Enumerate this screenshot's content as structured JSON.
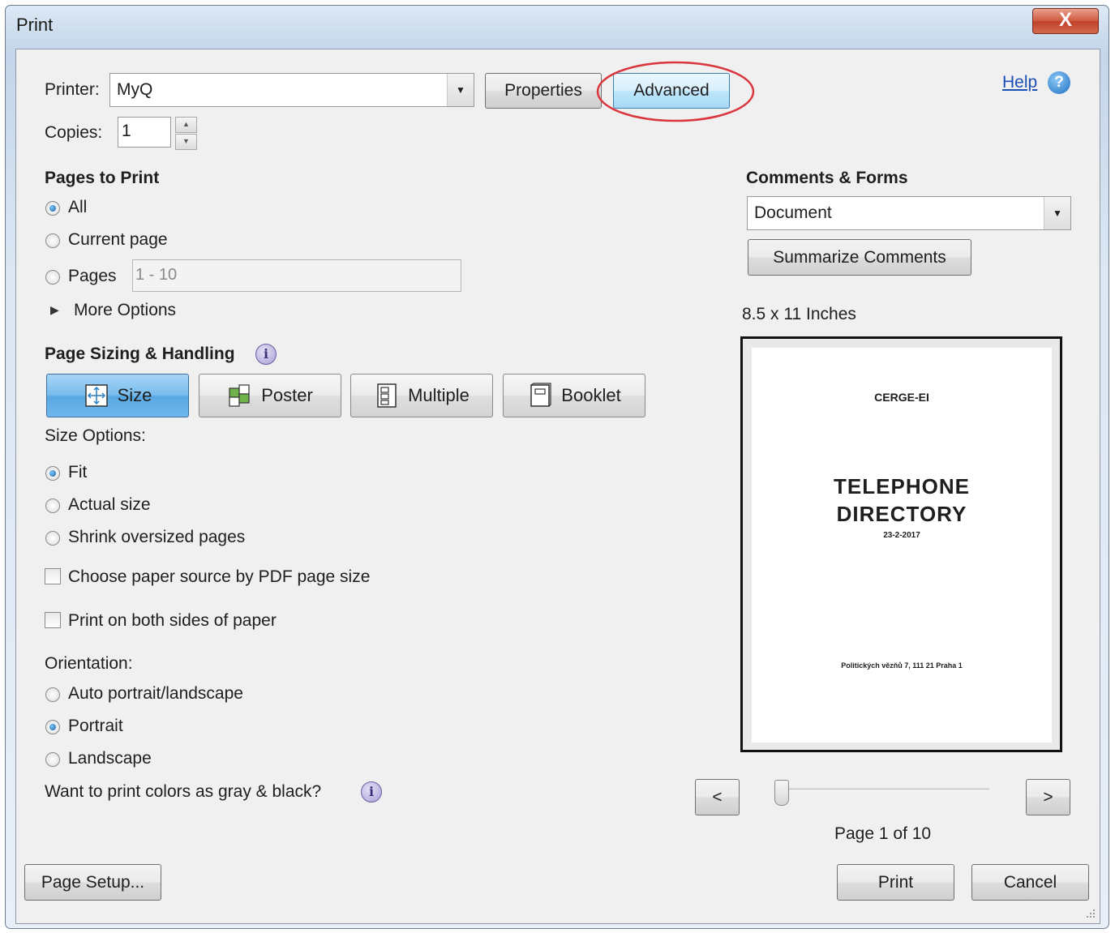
{
  "window": {
    "title": "Print",
    "close_glyph": "X"
  },
  "printer": {
    "label": "Printer:",
    "value": "MyQ",
    "properties_label": "Properties",
    "advanced_label": "Advanced"
  },
  "copies": {
    "label": "Copies:",
    "value": "1"
  },
  "help": {
    "label": "Help",
    "icon": "help-icon"
  },
  "pages_to_print": {
    "heading": "Pages to Print",
    "all_label": "All",
    "current_label": "Current page",
    "pages_label": "Pages",
    "pages_value": "1 - 10",
    "more_options_label": "More Options",
    "selected": "All"
  },
  "page_sizing": {
    "heading": "Page Sizing & Handling",
    "tabs": [
      {
        "label": "Size",
        "icon": "size-icon",
        "selected": true
      },
      {
        "label": "Poster",
        "icon": "poster-icon",
        "selected": false
      },
      {
        "label": "Multiple",
        "icon": "multiple-icon",
        "selected": false
      },
      {
        "label": "Booklet",
        "icon": "booklet-icon",
        "selected": false
      }
    ],
    "size_options_label": "Size Options:",
    "fit_label": "Fit",
    "actual_label": "Actual size",
    "shrink_label": "Shrink oversized pages",
    "selected": "Fit",
    "paper_source_label": "Choose paper source by PDF page size",
    "paper_source_checked": false,
    "both_sides_label": "Print on both sides of paper",
    "both_sides_checked": false
  },
  "orientation": {
    "label": "Orientation:",
    "auto_label": "Auto portrait/landscape",
    "portrait_label": "Portrait",
    "landscape_label": "Landscape",
    "selected": "Portrait"
  },
  "gray_label": "Want to print colors as gray & black?",
  "comments_forms": {
    "heading": "Comments & Forms",
    "value": "Document",
    "summarize_label": "Summarize Comments"
  },
  "preview": {
    "paper_size": "8.5 x 11 Inches",
    "doc_header": "CERGE-EI",
    "doc_title_1": "TELEPHONE",
    "doc_title_2": "DIRECTORY",
    "doc_date": "23-2-2017",
    "doc_address": "Politických vězňů 7, 111 21 Praha 1",
    "prev_label": "<",
    "next_label": ">",
    "page_indicator": "Page 1 of 10",
    "page_current": 1,
    "page_total": 10
  },
  "footer": {
    "page_setup_label": "Page Setup...",
    "print_label": "Print",
    "cancel_label": "Cancel"
  },
  "colors": {
    "annotation_circle": "#d9363e",
    "link": "#1a4fb5",
    "selected_tab": "#6fb7ec"
  }
}
